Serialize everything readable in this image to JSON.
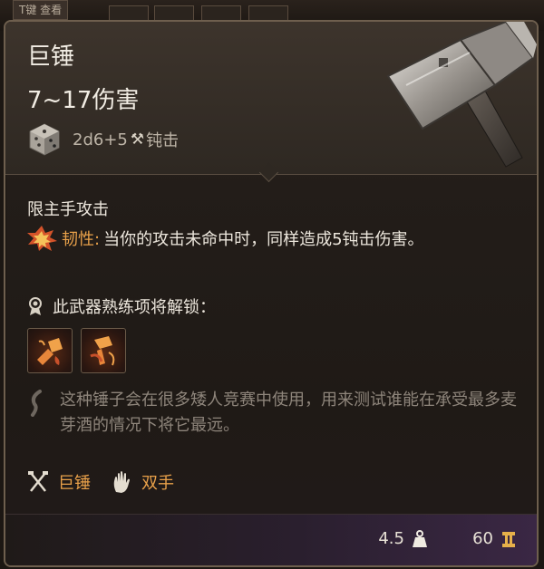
{
  "topbar": {
    "hint": "T键 查看"
  },
  "item": {
    "name": "巨锤",
    "damage_range": "7~17伤害",
    "dice": "2d6+5",
    "damage_type": "钝击",
    "restriction": "限主手攻击",
    "passive": {
      "name": "韧性:",
      "description": "当你的攻击未命中时，同样造成5钝击伤害。"
    },
    "proficiency_unlock": "此武器熟练项将解锁：",
    "lore": "这种锤子会在很多矮人竞赛中使用，用来测试谁能在承受最多麦芽酒的情况下将它最远。",
    "tags": [
      {
        "label": "巨锤",
        "icon": "crossed-weapons-icon"
      },
      {
        "label": "双手",
        "icon": "hand-icon"
      }
    ],
    "weight": "4.5",
    "price": "60"
  },
  "colors": {
    "accent": "#e9a14a",
    "lore": "#8e857b",
    "text": "#ece6dc"
  }
}
